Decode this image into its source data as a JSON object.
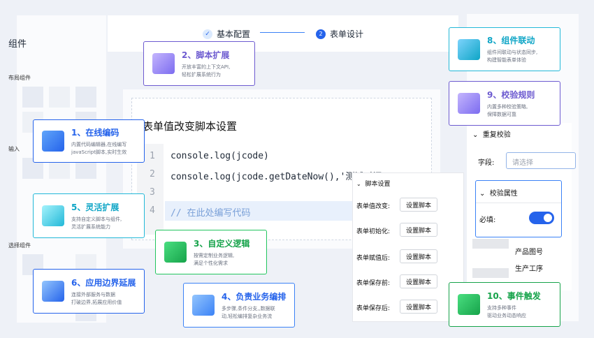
{
  "left": {
    "title": "组件",
    "layout_label": "布局组件",
    "input_label": "输入",
    "select_label": "选择组件"
  },
  "steps": {
    "step1": "基本配置",
    "step2_num": "2",
    "step2": "表单设计"
  },
  "editor": {
    "title": "表单值改变脚本设置",
    "line_numbers": [
      "1",
      "2",
      "3",
      "4"
    ],
    "line1": "console.log(jcode)",
    "line2": "console.log(jcode.getDateNow(),'测试时间:1)",
    "line4": "// 在此处编写代码"
  },
  "features": [
    {
      "title": "1、在线编码",
      "desc1": "内置代码编辑器,在线编写",
      "desc2": "javaScript脚本,实时生效",
      "color": "#2563eb"
    },
    {
      "title": "2、脚本扩展",
      "desc1": "开放丰富的上下文API,",
      "desc2": "轻松扩展系统行为",
      "color": "#6d5bd0"
    },
    {
      "title": "3、自定义逻辑",
      "desc1": "按需定制业务逻辑,",
      "desc2": "满足个性化需求",
      "color": "#16a34a"
    },
    {
      "title": "4、负责业务编排",
      "desc1": "多步骤,条件分支,,数据联",
      "desc2": "动,轻松编排复杂业务流",
      "color": "#2563eb"
    },
    {
      "title": "5、灵活扩展",
      "desc1": "支持自定义脚本与组件,",
      "desc2": "灵活扩展系统能力",
      "color": "#0ea5c6"
    },
    {
      "title": "6、应用边界延展",
      "desc1": "连接外部服务与数据",
      "desc2": "打破边界,拓展应用价值",
      "color": "#2563eb"
    },
    {
      "title": "8、组件联动",
      "desc1": "组件间联动与状态同步,",
      "desc2": "构建智能表单体验",
      "color": "#0ea5c6"
    },
    {
      "title": "9、校验规则",
      "desc1": "内置多种校验策略,",
      "desc2": "保障数据可靠",
      "color": "#6d5bd0"
    },
    {
      "title": "10、事件触发",
      "desc1": "支持多种事件",
      "desc2": "驱动业务动态响应",
      "color": "#16a34a"
    }
  ],
  "script_panel": {
    "header": "脚本设置",
    "rows": [
      {
        "label": "表单值改变:",
        "button": "设置脚本"
      },
      {
        "label": "表单初始化:",
        "button": "设置脚本"
      },
      {
        "label": "表单赋值后:",
        "button": "设置脚本"
      },
      {
        "label": "表单保存前:",
        "button": "设置脚本"
      },
      {
        "label": "表单保存后:",
        "button": "设置脚本"
      }
    ]
  },
  "right": {
    "repeat_check": "重复校验",
    "field_label": "字段:",
    "field_placeholder": "请选择",
    "verify_title": "校验属性",
    "required_label": "必填:",
    "required_on": true,
    "opt1": "产品图号",
    "opt2": "生产工序"
  }
}
